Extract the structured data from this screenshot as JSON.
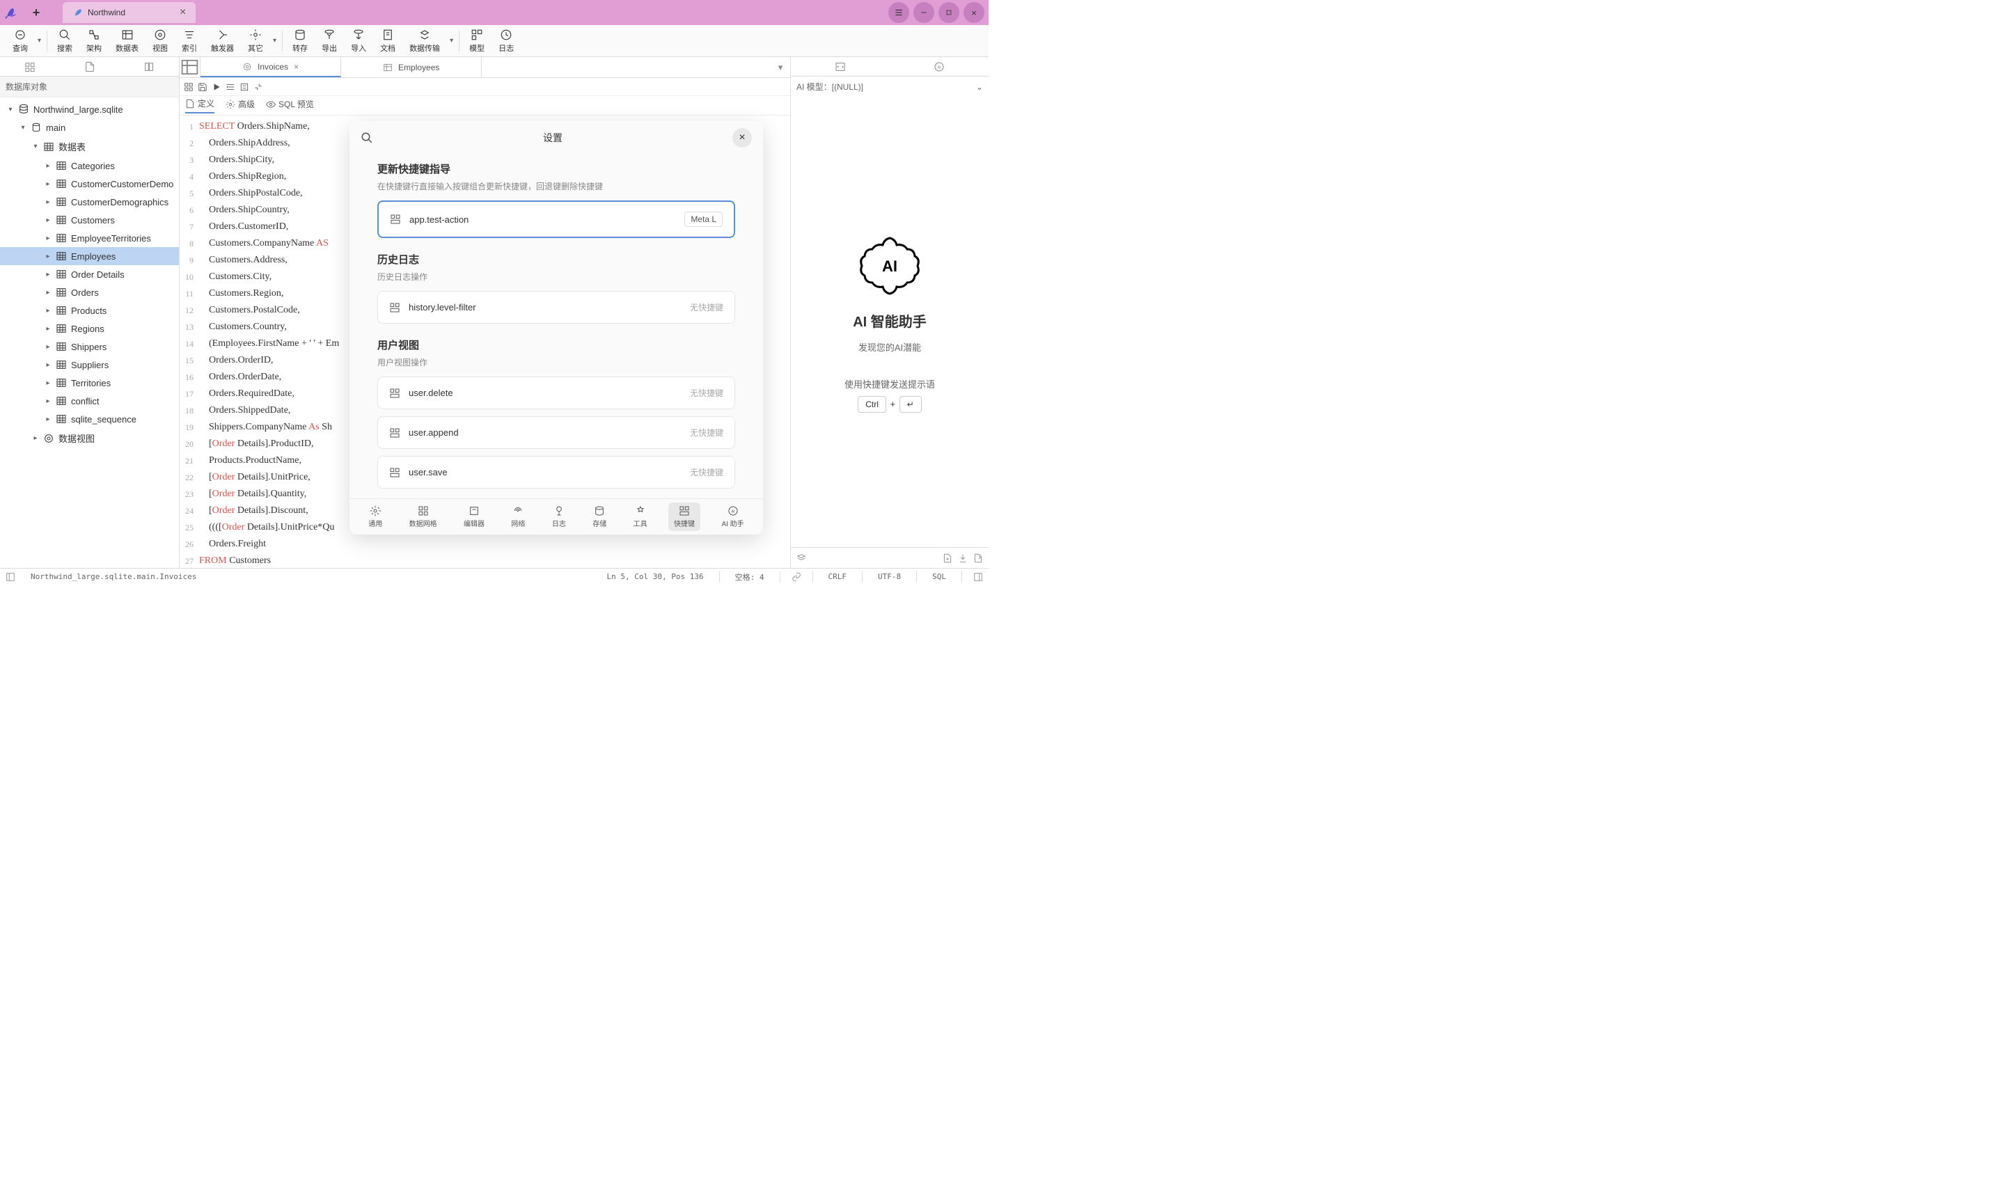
{
  "titlebar": {
    "tab_label": "Northwind"
  },
  "toolbar": {
    "items": [
      "查询",
      "搜索",
      "架构",
      "数据表",
      "视图",
      "索引",
      "触发器",
      "其它",
      "转存",
      "导出",
      "导入",
      "文档",
      "数据传输",
      "模型",
      "日志"
    ]
  },
  "sidebar": {
    "header": "数据库对象",
    "root": "Northwind_large.sqlite",
    "schema": "main",
    "tables_label": "数据表",
    "views_label": "数据视图",
    "tables": [
      "Categories",
      "CustomerCustomerDemo",
      "CustomerDemographics",
      "Customers",
      "EmployeeTerritories",
      "Employees",
      "Order Details",
      "Orders",
      "Products",
      "Regions",
      "Shippers",
      "Suppliers",
      "Territories",
      "conflict",
      "sqlite_sequence"
    ],
    "selected_index": 5
  },
  "editor": {
    "tabs": [
      {
        "label": "Invoices",
        "active": true,
        "closable": true
      },
      {
        "label": "Employees",
        "active": false,
        "closable": false
      }
    ],
    "subtabs": {
      "define": "定义",
      "advanced": "高级",
      "preview": "SQL 预览",
      "active": "define"
    },
    "code_lines": [
      {
        "kw": "SELECT",
        "rest": " Orders.ShipName,"
      },
      {
        "kw": "",
        "rest": "    Orders.ShipAddress,"
      },
      {
        "kw": "",
        "rest": "    Orders.ShipCity,"
      },
      {
        "kw": "",
        "rest": "    Orders.ShipRegion,"
      },
      {
        "kw": "",
        "rest": "    Orders.ShipPostalCode,"
      },
      {
        "kw": "",
        "rest": "    Orders.ShipCountry,"
      },
      {
        "kw": "",
        "rest": "    Orders.CustomerID,"
      },
      {
        "kw": "",
        "rest": "    Customers.CompanyName ",
        "kw2": "AS",
        "rest2": " "
      },
      {
        "kw": "",
        "rest": "    Customers.Address,"
      },
      {
        "kw": "",
        "rest": "    Customers.City,"
      },
      {
        "kw": "",
        "rest": "    Customers.Region,"
      },
      {
        "kw": "",
        "rest": "    Customers.PostalCode,"
      },
      {
        "kw": "",
        "rest": "    Customers.Country,"
      },
      {
        "kw": "",
        "rest": "    (Employees.FirstName + ' ' + Em"
      },
      {
        "kw": "",
        "rest": "    Orders.OrderID,"
      },
      {
        "kw": "",
        "rest": "    Orders.OrderDate,"
      },
      {
        "kw": "",
        "rest": "    Orders.RequiredDate,"
      },
      {
        "kw": "",
        "rest": "    Orders.ShippedDate,"
      },
      {
        "kw": "",
        "rest": "    Shippers.CompanyName ",
        "kw2": "As",
        "rest2": " Sh"
      },
      {
        "kw": "",
        "rest": "    [",
        "kw2": "Order",
        "rest2": " Details].ProductID,"
      },
      {
        "kw": "",
        "rest": "    Products.ProductName,"
      },
      {
        "kw": "",
        "rest": "    [",
        "kw2": "Order",
        "rest2": " Details].UnitPrice,"
      },
      {
        "kw": "",
        "rest": "    [",
        "kw2": "Order",
        "rest2": " Details].Quantity,"
      },
      {
        "kw": "",
        "rest": "    [",
        "kw2": "Order",
        "rest2": " Details].Discount,"
      },
      {
        "kw": "",
        "rest": "    ((([",
        "kw2": "Order",
        "rest2": " Details].UnitPrice*Qu"
      },
      {
        "kw": "",
        "rest": "    Orders.Freight"
      },
      {
        "kw": "FROM",
        "rest": " Customers"
      }
    ]
  },
  "right": {
    "header": "AI 模型：[(NULL)]",
    "title": "AI 智能助手",
    "subtitle": "发现您的AI潜能",
    "hint": "使用快捷键发送提示语",
    "key1": "Ctrl",
    "plus": "+"
  },
  "statusbar": {
    "path": "Northwind_large.sqlite.main.Invoices",
    "pos": "Ln 5, Col 30, Pos 136",
    "spaces": "空格: 4",
    "eol": "CRLF",
    "enc": "UTF-8",
    "lang": "SQL"
  },
  "modal": {
    "title": "设置",
    "sections": {
      "update": {
        "title": "更新快捷键指导",
        "desc": "在快捷键行直接输入按键组合更新快捷键，回退键删除快捷键"
      },
      "history": {
        "title": "历史日志",
        "desc": "历史日志操作"
      },
      "user": {
        "title": "用户视图",
        "desc": "用户视图操作"
      }
    },
    "rows": [
      {
        "section": "update",
        "name": "app.test-action",
        "key": "Meta L",
        "active": true
      },
      {
        "section": "history",
        "name": "history.level-filter",
        "nokey": "无快捷键"
      },
      {
        "section": "user",
        "name": "user.delete",
        "nokey": "无快捷键"
      },
      {
        "section": "user",
        "name": "user.append",
        "nokey": "无快捷键"
      },
      {
        "section": "user",
        "name": "user.save",
        "nokey": "无快捷键"
      }
    ],
    "footer": [
      "通用",
      "数据网格",
      "编辑器",
      "网络",
      "日志",
      "存储",
      "工具",
      "快捷键",
      "AI 助手"
    ],
    "footer_active": 7
  }
}
